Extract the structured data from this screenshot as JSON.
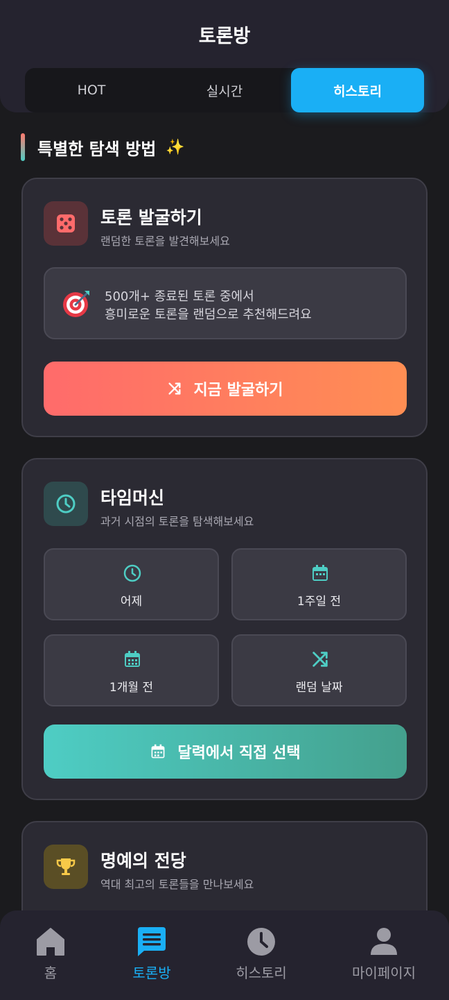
{
  "header": {
    "title": "토론방",
    "tabs": [
      {
        "label": "HOT"
      },
      {
        "label": "실시간"
      },
      {
        "label": "히스토리"
      }
    ],
    "active_tab": "히스토리"
  },
  "section": {
    "title": "특별한 탐색 방법",
    "emoji": "✨"
  },
  "discover": {
    "icon": "dice-icon",
    "title": "토론 발굴하기",
    "subtitle": "랜덤한 토론을 발견해보세요",
    "info_icon": "target-icon",
    "info_line1": "500개+ 종료된 토론 중에서",
    "info_line2": "흥미로운 토론을 랜덤으로 추천해드려요",
    "button_icon": "shuffle-icon",
    "button_label": "지금 발굴하기",
    "accent_from": "#ff6b6b",
    "accent_to": "#ff8e53"
  },
  "timemachine": {
    "icon": "clock-icon",
    "title": "타임머신",
    "subtitle": "과거 시점의 토론을 탐색해보세요",
    "options": [
      {
        "label": "어제",
        "icon": "clock-icon"
      },
      {
        "label": "1주일 전",
        "icon": "calendar-icon"
      },
      {
        "label": "1개월 전",
        "icon": "calendar-icon"
      },
      {
        "label": "랜덤 날짜",
        "icon": "shuffle-icon"
      }
    ],
    "button_icon": "calendar-icon",
    "button_label": "달력에서 직접 선택",
    "accent": "#4ecdc4"
  },
  "halloffame": {
    "icon": "trophy-icon",
    "title": "명예의 전당",
    "subtitle": "역대 최고의 토론들을 만나보세요"
  },
  "bottom_nav": {
    "items": [
      {
        "label": "홈",
        "icon": "home-icon"
      },
      {
        "label": "토론방",
        "icon": "chat-icon"
      },
      {
        "label": "히스토리",
        "icon": "clock-icon"
      },
      {
        "label": "마이페이지",
        "icon": "user-icon"
      }
    ],
    "active": "토론방"
  }
}
